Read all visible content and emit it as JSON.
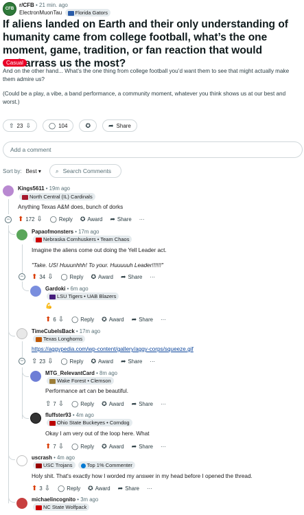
{
  "post": {
    "subreddit": "r/CFB",
    "time": "• 21 min. ago",
    "author": "ElectronMuonTau",
    "author_flair": "Florida Gators",
    "title": "If aliens landed on Earth and their only understanding of humanity came from college football, what’s the one moment, game, tradition, or fan reaction that would embarrass us the most?",
    "flair": "Casual",
    "body_1": "And on the other hand... What’s the one thing from college football you’d want them to see that might actually make them admire us?",
    "body_2": "(Could be a play, a vibe, a band performance, a community moment, whatever you think shows us at our best and worst.)",
    "votes": "23",
    "comments": "104",
    "share_label": "Share"
  },
  "add_comment_placeholder": "Add a comment",
  "sort": {
    "label": "Sort by:",
    "value": "Best",
    "search_placeholder": "Search Comments"
  },
  "action_labels": {
    "reply": "Reply",
    "award": "Award",
    "share": "Share",
    "more": "···"
  },
  "comments": [
    {
      "user": "Kings5611",
      "time": "• 19m ago",
      "flair": "North Central (IL) Cardinals",
      "text": "Anything Texas A&M does, bunch of dorks",
      "votes": "172"
    },
    {
      "user": "Papaofmonsters",
      "time": "• 17m ago",
      "flair": "Nebraska Cornhuskers • Team Chaos",
      "text": "Imagine the aliens come out doing the Yell Leader act.",
      "text2": "\"Take. US! Huuunhhh! To your. Huuuuuh Leader!!!!!!\"",
      "votes": "34"
    },
    {
      "user": "Gardoki",
      "time": "• 6m ago",
      "flair": "LSU Tigers • UAB Blazers",
      "text": "💪",
      "votes": "6"
    },
    {
      "user": "TimeCubeIsBack",
      "time": "• 17m ago",
      "flair": "Texas Longhorns",
      "text": "https://aggypedia.com/wp-content/gallery/aggy-corps/squeeze.gif",
      "votes": "23"
    },
    {
      "user": "MTG_RelevantCard",
      "time": "• 8m ago",
      "flair": "Wake Forest • Clemson",
      "text": "Performance art can be beautiful.",
      "votes": "7"
    },
    {
      "user": "fluffster93",
      "time": "• 4m ago",
      "flair": "Ohio State Buckeyes • Corndog",
      "text": "Okay I am very out of the loop here. What",
      "votes": "7"
    },
    {
      "user": "uscrash",
      "time": "• 4m ago",
      "flair": "USC Trojans",
      "flair2": "Top 1% Commenter",
      "text": "Holy shit. That's exactly how I worded my answer in my head before I opened the thread.",
      "votes": "3"
    },
    {
      "user": "michaelincognito",
      "time": "• 3m ago",
      "flair": "NC State Wolfpack"
    }
  ]
}
